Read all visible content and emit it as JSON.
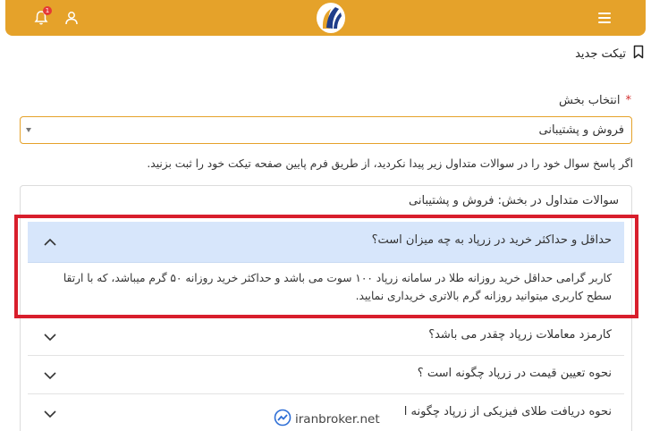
{
  "header": {
    "notification_count": "1",
    "icons": {
      "menu": "hamburger-menu-icon",
      "bell": "bell-icon",
      "user": "user-icon",
      "logo": "zarpad-logo"
    },
    "colors": {
      "brand": "#e5a22a",
      "badge": "#e53935"
    }
  },
  "page": {
    "title": "تیکت جدید",
    "title_icon": "bookmark-icon"
  },
  "form": {
    "section_label": "انتخاب بخش",
    "required_mark": "*",
    "section_value": "فروش و پشتیبانی",
    "hint": "اگر پاسخ سوال خود را در سوالات متداول زیر پیدا نکردید، از طریق فرم پایین صفحه تیکت خود را ثبت بزنید."
  },
  "faq": {
    "title": "سوالات متداول در بخش: فروش و پشتیبانی",
    "items": [
      {
        "question": "حداقل و حداکثر خرید در زرپاد به چه میزان است؟",
        "expanded": true,
        "answer": "کاربر گرامی حداقل خرید روزانه طلا در سامانه زرپاد ۱۰۰ سوت می باشد و حداکثر خرید روزانه ۵۰ گرم میباشد، که با ارتقا سطح کاربری میتوانید روزانه گرم بالاتری خریداری نمایید."
      },
      {
        "question": "کارمزد معاملات زرپاد چقدر می باشد؟",
        "expanded": false
      },
      {
        "question": "نحوه تعیین قیمت در زرپاد چگونه است ؟",
        "expanded": false
      },
      {
        "question": "نحوه دریافت طلای فیزیکی از زرپاد چگونه ا",
        "expanded": false
      }
    ],
    "highlight_color": "#d81e2c"
  },
  "watermark": {
    "text": "iranbroker.net",
    "icon": "trend-chart-icon"
  }
}
